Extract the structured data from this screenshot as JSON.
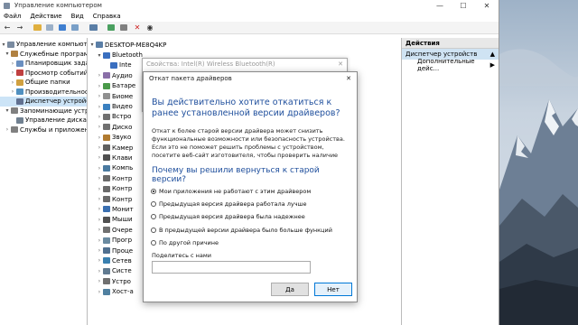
{
  "window": {
    "title": "Управление компьютером",
    "controls": [
      "—",
      "☐",
      "✕"
    ]
  },
  "menu": [
    "Файл",
    "Действие",
    "Вид",
    "Справка"
  ],
  "toolbar_icons": [
    "back-icon",
    "forward-icon",
    "folder-icon",
    "properties-icon",
    "help-icon",
    "console-icon",
    "monitor-icon",
    "driver-update-icon",
    "disable-icon",
    "uninstall-icon",
    "scan-icon"
  ],
  "left_tree": [
    {
      "label": "Управление компьютером (лс",
      "indent": 0,
      "color": "#7a8ba0"
    },
    {
      "label": "Служебные программы",
      "indent": 1,
      "color": "#b08040"
    },
    {
      "label": "Планировщик заданий",
      "indent": 2,
      "color": "#6a8fc0"
    },
    {
      "label": "Просмотр событий",
      "indent": 2,
      "color": "#c04040"
    },
    {
      "label": "Общие папки",
      "indent": 2,
      "color": "#d0a040"
    },
    {
      "label": "Производительность",
      "indent": 2,
      "color": "#5090c0"
    },
    {
      "label": "Диспетчер устройств",
      "indent": 2,
      "color": "#607090",
      "selected": true
    },
    {
      "label": "Запоминающие устройства",
      "indent": 1,
      "color": "#808080"
    },
    {
      "label": "Управление дисками",
      "indent": 2,
      "color": "#708090"
    },
    {
      "label": "Службы и приложения",
      "indent": 1,
      "color": "#808080"
    }
  ],
  "device_tree": {
    "root": "DESKTOP-ME8Q4KP",
    "items": [
      {
        "label": "Bluetooth",
        "expanded": true
      },
      {
        "label": "Inte",
        "child": true
      },
      {
        "label": "Аудио"
      },
      {
        "label": "Батаре"
      },
      {
        "label": "Биоме"
      },
      {
        "label": "Видео"
      },
      {
        "label": "Встро"
      },
      {
        "label": "Диско"
      },
      {
        "label": "Звуко"
      },
      {
        "label": "Камер"
      },
      {
        "label": "Клави"
      },
      {
        "label": "Компь"
      },
      {
        "label": "Контр"
      },
      {
        "label": "Контр"
      },
      {
        "label": "Контр"
      },
      {
        "label": "Монит"
      },
      {
        "label": "Мыши"
      },
      {
        "label": "Очере"
      },
      {
        "label": "Прогр"
      },
      {
        "label": "Проце"
      },
      {
        "label": "Сетев"
      },
      {
        "label": "Систе"
      },
      {
        "label": "Устро"
      },
      {
        "label": "Хост-а"
      }
    ]
  },
  "actions": {
    "header": "Действия",
    "section": "Диспетчер устройств",
    "section_arrow": "▲",
    "more": "Дополнительные дейс...",
    "more_arrow": "▶"
  },
  "props_dialog": {
    "title": "Свойства: Intel(R) Wireless Bluetooth(R)",
    "close": "✕"
  },
  "rollback": {
    "title": "Откат пакета драйверов",
    "close": "✕",
    "heading": "Вы действительно хотите откатиться к ранее установленной версии драйверов?",
    "paragraph": "Откат к более старой версии драйвера может снизить функциональные возможности или безопасность устройства. Если это не поможет решить проблемы с устройством, посетите веб-сайт изготовителя, чтобы проверить наличие обновленных",
    "question": "Почему вы решили вернуться к старой версии?",
    "options": [
      {
        "label": "Мои приложения не работают с этим драйвером",
        "selected": true
      },
      {
        "label": "Предыдущая версия драйвера работала лучше",
        "selected": false
      },
      {
        "label": "Предыдущая версия драйвера была надежнее",
        "selected": false
      },
      {
        "label": "В предыдущей версии драйвера было больше функций",
        "selected": false
      },
      {
        "label": "По другой причине",
        "selected": false
      }
    ],
    "share_label": "Поделитесь с нами",
    "share_value": "",
    "yes": "Да",
    "no": "Нет"
  }
}
